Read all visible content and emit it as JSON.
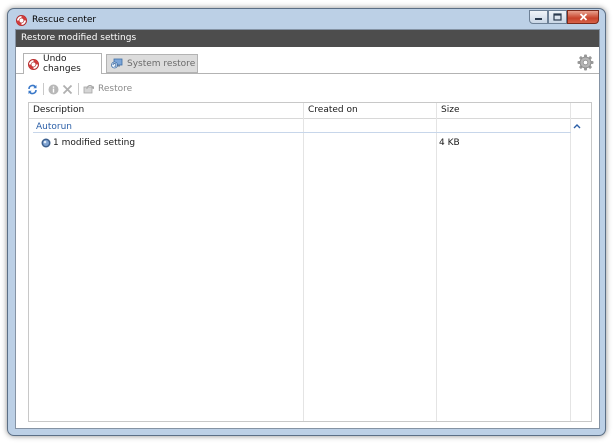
{
  "window": {
    "title": "Rescue center",
    "controls": {
      "minimize": "minimize",
      "maximize": "maximize",
      "close": "close"
    }
  },
  "header": {
    "title": "Restore modified settings"
  },
  "tabs": [
    {
      "label": "Undo changes",
      "active": true,
      "icon": "lifebuoy-icon"
    },
    {
      "label": "System restore",
      "active": false,
      "icon": "system-restore-icon"
    }
  ],
  "toolbar": {
    "restore_label": "Restore"
  },
  "table": {
    "columns": [
      "Description",
      "Created on",
      "Size"
    ],
    "groups": [
      {
        "label": "Autorun",
        "rows": [
          {
            "description": "1 modified setting",
            "created_on": "",
            "size": "4 KB"
          }
        ]
      }
    ]
  },
  "colors": {
    "header_bar": "#4d4d4d",
    "group_label": "#2b5fa7",
    "window_frame": "#bcd0e6"
  }
}
